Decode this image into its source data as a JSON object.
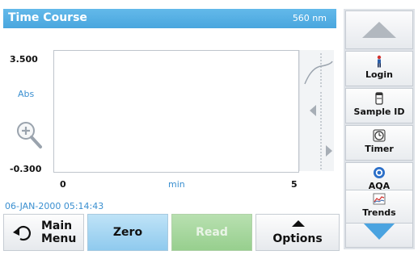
{
  "header": {
    "title": "Time Course",
    "wavelength": "560 nm"
  },
  "graph": {
    "y_max": "3.500",
    "y_min": "-0.300",
    "y_unit": "Abs",
    "x_min": "0",
    "x_max": "5",
    "x_unit": "min"
  },
  "timestamp": "06-JAN-2000  05:14:43",
  "side_menu": {
    "items": [
      {
        "label": "Login",
        "icon": "login-person-icon"
      },
      {
        "label": "Sample ID",
        "icon": "sample-vial-icon"
      },
      {
        "label": "Timer",
        "icon": "timer-icon"
      },
      {
        "label": "AQA",
        "icon": "aqa-icon"
      },
      {
        "label": "Trends",
        "icon": "trends-chart-icon"
      }
    ]
  },
  "bottom_bar": {
    "main_menu": [
      "Main",
      "Menu"
    ],
    "zero": "Zero",
    "read": "Read",
    "options": "Options"
  },
  "colors": {
    "header_blue": "#49a6de",
    "zero_button": "#8fcaee",
    "read_button_disabled": "#97cf8e",
    "scroll_arrow_blue": "#4aa3e0"
  }
}
